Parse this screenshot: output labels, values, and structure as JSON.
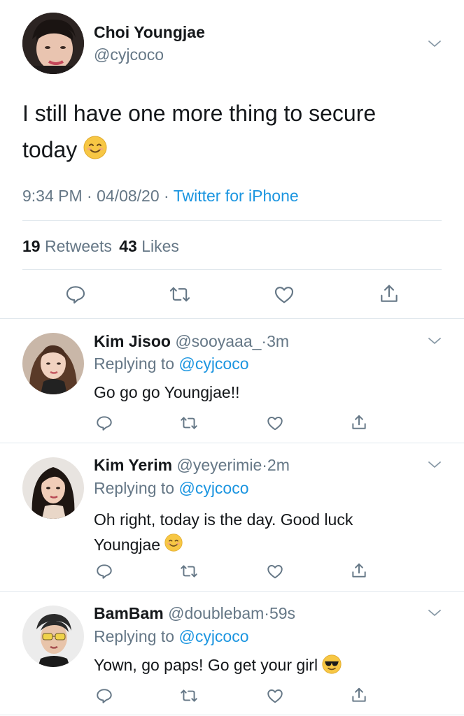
{
  "main_tweet": {
    "author_name": "Choi Youngjae",
    "author_handle": "@cyjcoco",
    "text": "I still have one more thing to secure today",
    "emoji": "smiling-face-emoji",
    "time": "9:34 PM",
    "date": "04/08/20",
    "separator": "·",
    "source": "Twitter for iPhone",
    "retweets_count": "19",
    "retweets_label": "Retweets",
    "likes_count": "43",
    "likes_label": "Likes"
  },
  "replies": [
    {
      "author_name": "Kim Jisoo",
      "author_handle": "@sooyaaa_",
      "age": "3m",
      "replying_label": "Replying to",
      "replying_to": "@cyjcoco",
      "text": "Go go go Youngjae!!"
    },
    {
      "author_name": "Kim Yerim",
      "author_handle": "@yeyerimie",
      "age": "2m",
      "replying_label": "Replying to",
      "replying_to": "@cyjcoco",
      "text_line1": "Oh right, today is the day. Good luck",
      "text_line2": "Youngjae",
      "emoji": "smiling-face-emoji"
    },
    {
      "author_name": "BamBam",
      "author_handle": "@doublebam",
      "age": "59s",
      "replying_label": "Replying to",
      "replying_to": "@cyjcoco",
      "text": "Yown, go paps! Go get your girl",
      "emoji": "sunglasses-face-emoji"
    }
  ],
  "dot": "·",
  "colors": {
    "link": "#1b95e0",
    "muted": "#657786",
    "divider": "#e1e8ed",
    "emoji": "#f7c744"
  }
}
